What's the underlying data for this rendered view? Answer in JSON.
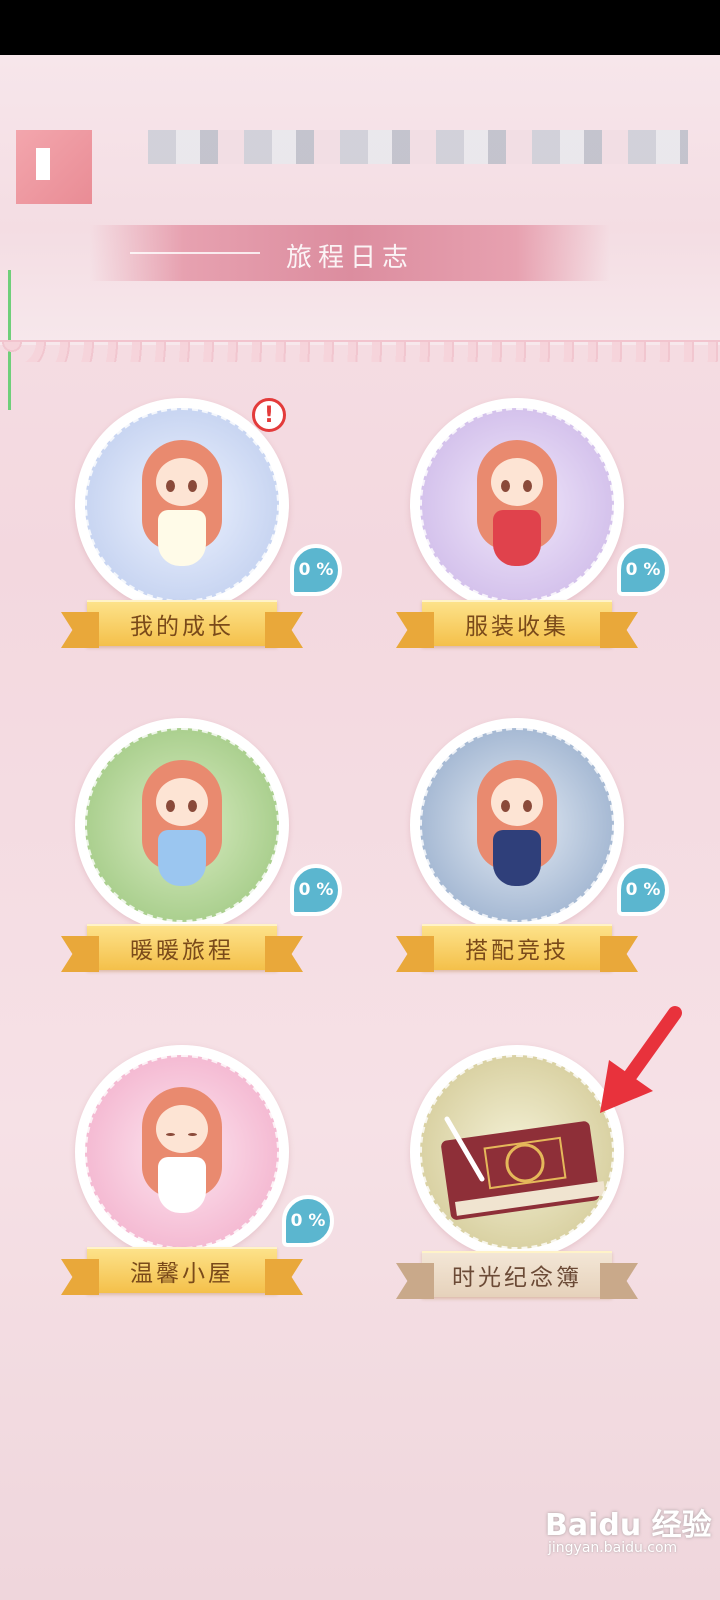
{
  "header": {
    "title": "旅程日志"
  },
  "cards": [
    {
      "label": "我的成长",
      "progress": "0 %"
    },
    {
      "label": "服装收集",
      "progress": "0 %"
    },
    {
      "label": "暖暖旅程",
      "progress": "0 %"
    },
    {
      "label": "搭配竞技",
      "progress": "0 %"
    },
    {
      "label": "温馨小屋",
      "progress": "0 %"
    },
    {
      "label": "时光纪念簿"
    }
  ],
  "alert_mark": "!",
  "watermark": {
    "logo": "Baidu 经验",
    "url": "jingyan.baidu.com"
  },
  "colors": {
    "ribbon": "#f4c04a",
    "badge": "#5bb6cf",
    "arrow": "#e8323c"
  }
}
